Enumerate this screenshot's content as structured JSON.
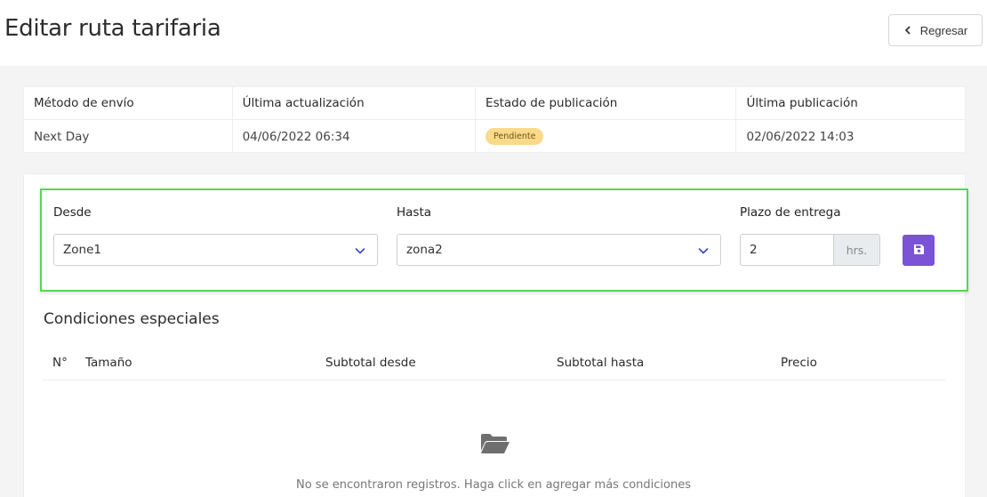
{
  "header": {
    "title": "Editar ruta tarifaria",
    "back_label": "Regresar"
  },
  "info": {
    "columns": [
      "Método de envío",
      "Última actualización",
      "Estado de publicación",
      "Última publicación"
    ],
    "shipping_method": "Next Day",
    "last_update": "04/06/2022 06:34",
    "status": "Pendiente",
    "last_publication": "02/06/2022 14:03"
  },
  "route": {
    "from_label": "Desde",
    "from_value": "Zone1",
    "to_label": "Hasta",
    "to_value": "zona2",
    "lead_time_label": "Plazo de entrega",
    "lead_time_value": "2",
    "lead_time_unit": "hrs."
  },
  "conditions": {
    "title": "Condiciones especiales",
    "columns": [
      "N°",
      "Tamaño",
      "Subtotal desde",
      "Subtotal hasta",
      "Precio"
    ],
    "empty_message": "No se encontraron registros. Haga click en agregar más condiciones"
  },
  "colors": {
    "accent": "#7b53d6",
    "badge_pending": "#fbd98a",
    "highlight_border": "#53d853"
  },
  "icons": {
    "back": "chevron-left-icon",
    "select": "chevron-down-icon",
    "save": "floppy-disk-icon",
    "empty": "folder-open-icon"
  }
}
